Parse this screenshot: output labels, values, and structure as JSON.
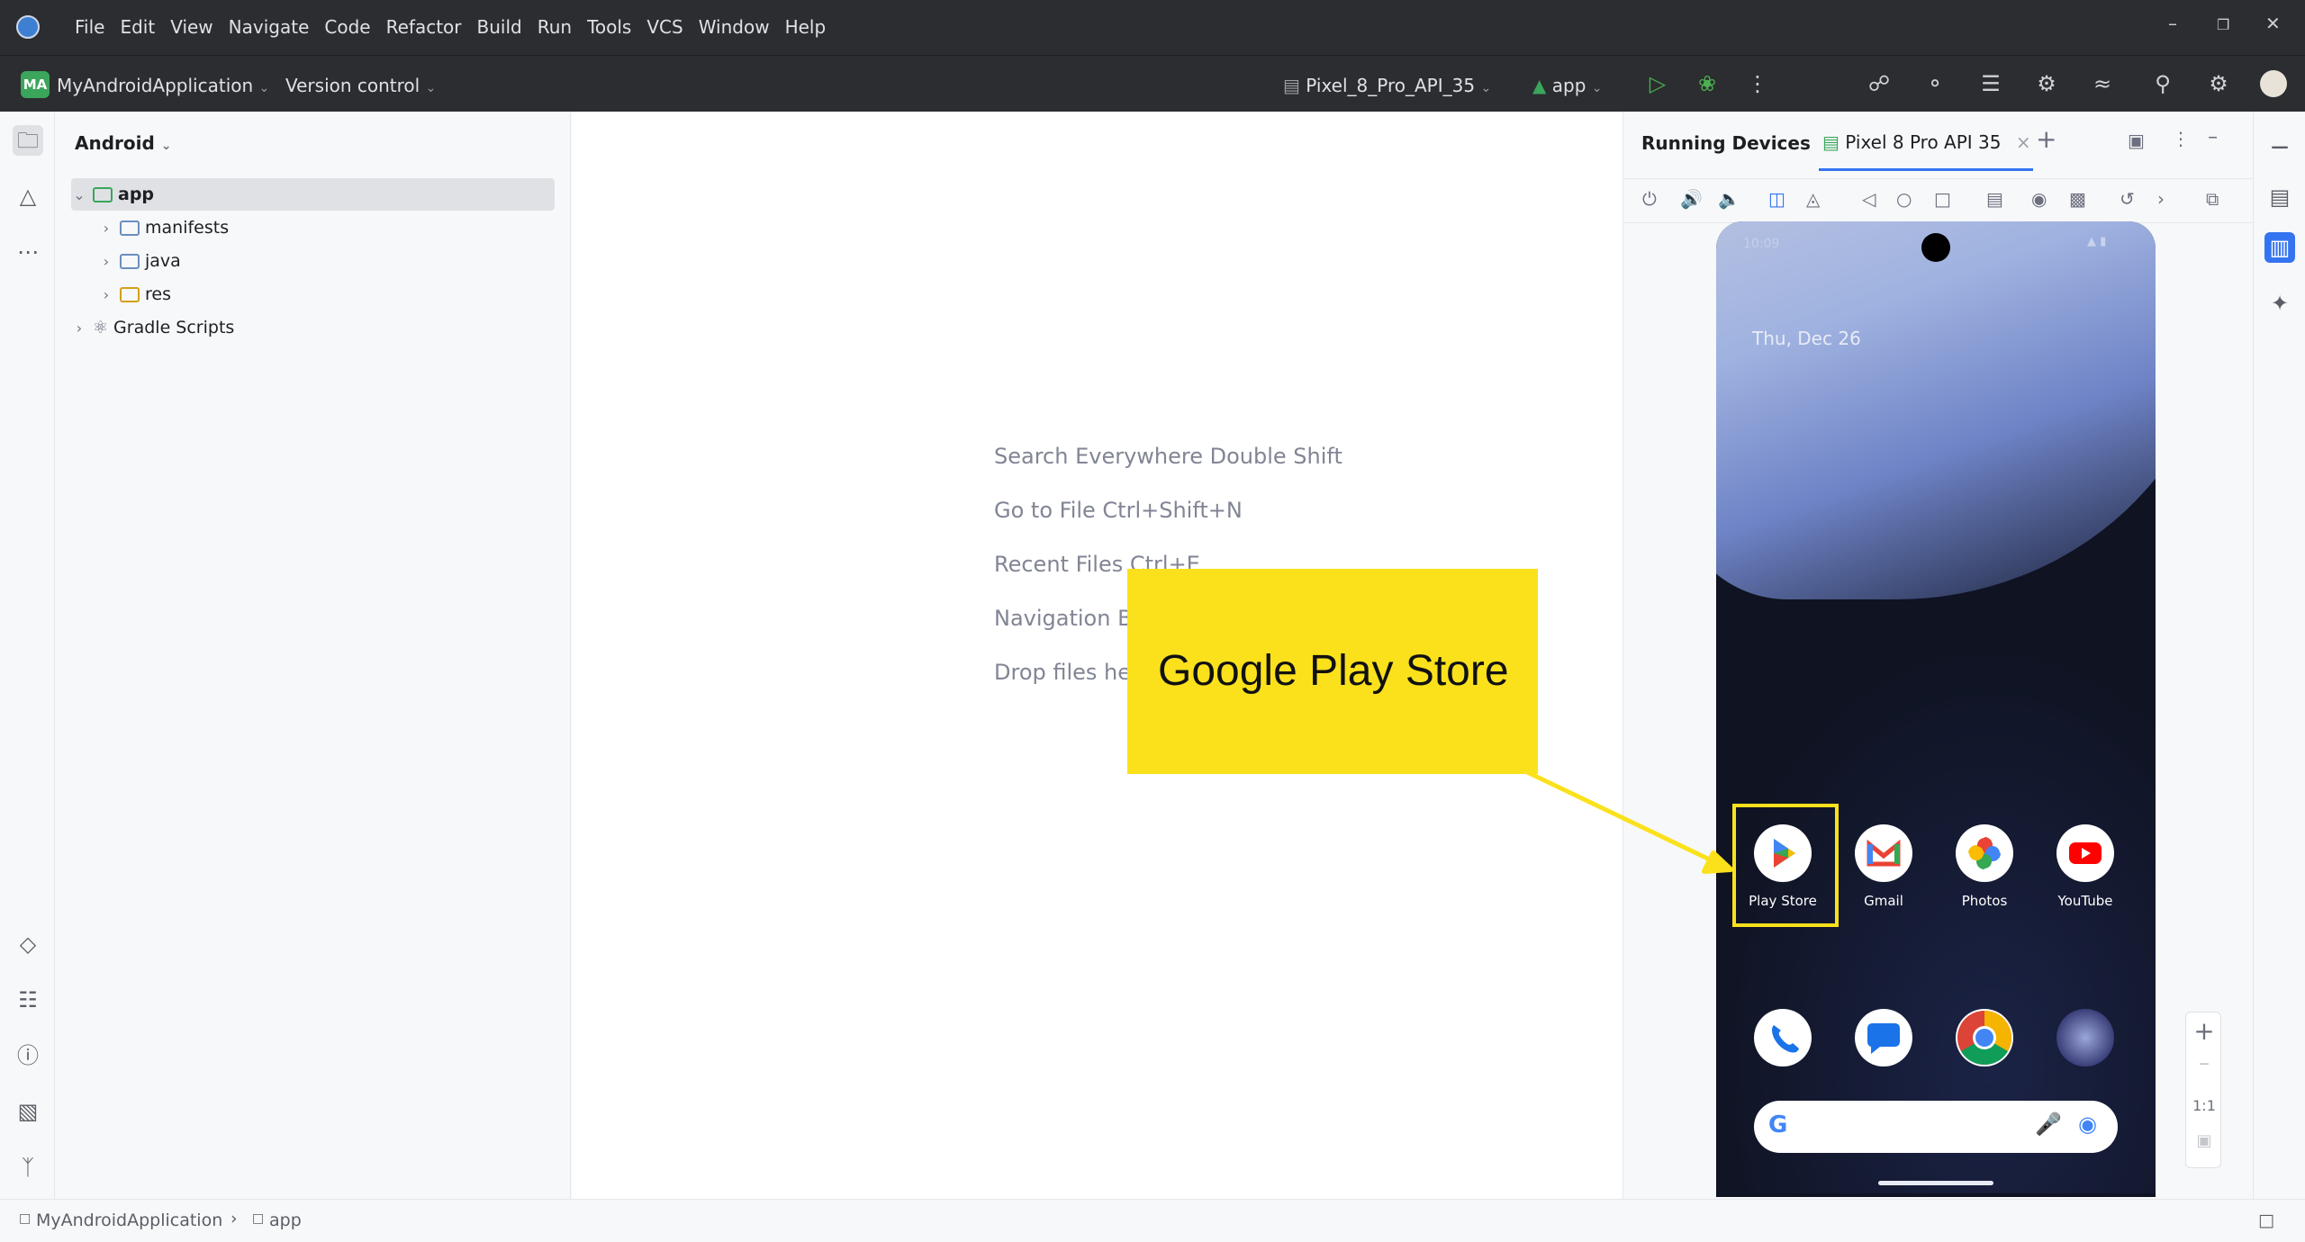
{
  "titlebar": {
    "menu": [
      "File",
      "Edit",
      "View",
      "Navigate",
      "Code",
      "Refactor",
      "Build",
      "Run",
      "Tools",
      "VCS",
      "Window",
      "Help"
    ],
    "minimize_icon": "minimize-icon",
    "restore_icon": "restore-icon",
    "close_icon": "close-icon"
  },
  "toolbar": {
    "project_badge": "MA",
    "project_name": "MyAndroidApplication",
    "vcs": "Version control",
    "device": "Pixel_8_Pro_API_35",
    "run_config": "app"
  },
  "project_panel": {
    "view_mode": "Android",
    "tree": {
      "app": "app",
      "manifests": "manifests",
      "java": "java",
      "res": "res",
      "gradle": "Gradle Scripts"
    }
  },
  "editor": {
    "hints": [
      "Search Everywhere Double Shift",
      "Go to File Ctrl+Shift+N",
      "Recent Files Ctrl+E",
      "Navigation Ba",
      "Drop files her"
    ]
  },
  "running_devices": {
    "title": "Running Devices",
    "tab": "Pixel 8 Pro API 35",
    "zoom_label": "1:1"
  },
  "phone": {
    "status_time": "10:09",
    "date": "Thu, Dec 26",
    "apps_row1": [
      "Play Store",
      "Gmail",
      "Photos",
      "YouTube"
    ]
  },
  "statusbar": {
    "crumbs": [
      "MyAndroidApplication",
      "app"
    ]
  },
  "annotation": {
    "callout": "Google Play Store",
    "color": "#fbe11c"
  },
  "colors": {
    "accent": "#3574f0",
    "toolbar_bg": "#2b2d30",
    "android_green": "#3ba55c"
  }
}
